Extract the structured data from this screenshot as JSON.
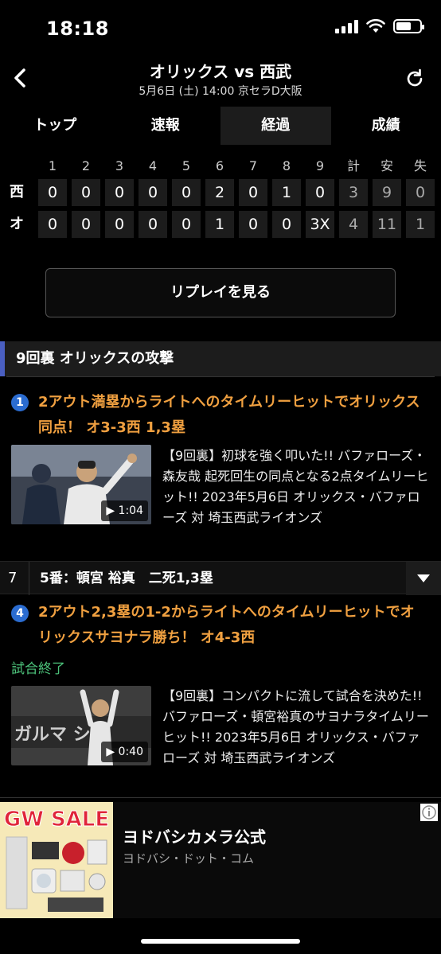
{
  "status_bar": {
    "time": "18:18"
  },
  "header": {
    "title": "オリックス vs 西武",
    "subtitle": "5月6日 (土) 14:00 京セラD大阪"
  },
  "tabs": [
    {
      "label": "トップ"
    },
    {
      "label": "速報"
    },
    {
      "label": "経過",
      "active": true
    },
    {
      "label": "成績"
    }
  ],
  "scoreboard": {
    "headers": [
      "1",
      "2",
      "3",
      "4",
      "5",
      "6",
      "7",
      "8",
      "9",
      "計",
      "安",
      "失"
    ],
    "rows": [
      {
        "team": "西",
        "cells": [
          "0",
          "0",
          "0",
          "0",
          "0",
          "2",
          "0",
          "1",
          "0",
          "3",
          "9",
          "0"
        ]
      },
      {
        "team": "オ",
        "cells": [
          "0",
          "0",
          "0",
          "0",
          "0",
          "1",
          "0",
          "0",
          "3X",
          "4",
          "11",
          "1"
        ]
      }
    ]
  },
  "replay_button": "リプレイを見る",
  "inning_header": "9回裏 オリックスの攻撃",
  "plays": [
    {
      "number": "1",
      "text": "2アウト満塁からライトへのタイムリーヒットでオリックス同点！ オ3-3西 1,3塁",
      "video": {
        "duration": "1:04",
        "caption": "【9回裏】初球を強く叩いた!! バファローズ・森友哉 起死回生の同点となる2点タイムリーヒット!! 2023年5月6日 オリックス・バファローズ 対 埼玉西武ライオンズ"
      }
    },
    {
      "number": "4",
      "text": "2アウト2,3塁の1-2からライトへのタイムリーヒットでオリックスサヨナラ勝ち！ オ4-3西",
      "status": "試合終了",
      "video": {
        "duration": "0:40",
        "caption": "【9回裏】コンパクトに流して試合を決めた!! バファローズ・頓宮裕真のサヨナラタイムリーヒット!! 2023年5月6日 オリックス・バファローズ 対 埼玉西武ライオンズ"
      }
    }
  ],
  "at_bat": {
    "number": "7",
    "text": "5番：頓宮 裕真　二死1,3塁"
  },
  "ad": {
    "image_text": "GW SALE",
    "title": "ヨドバシカメラ公式",
    "subtitle": "ヨドバシ・ドット・コム"
  },
  "colors": {
    "accent": "#f0a040",
    "section_bar": "#4a5fc1",
    "badge": "#2b6cd0",
    "game_end": "#4cc27a"
  }
}
